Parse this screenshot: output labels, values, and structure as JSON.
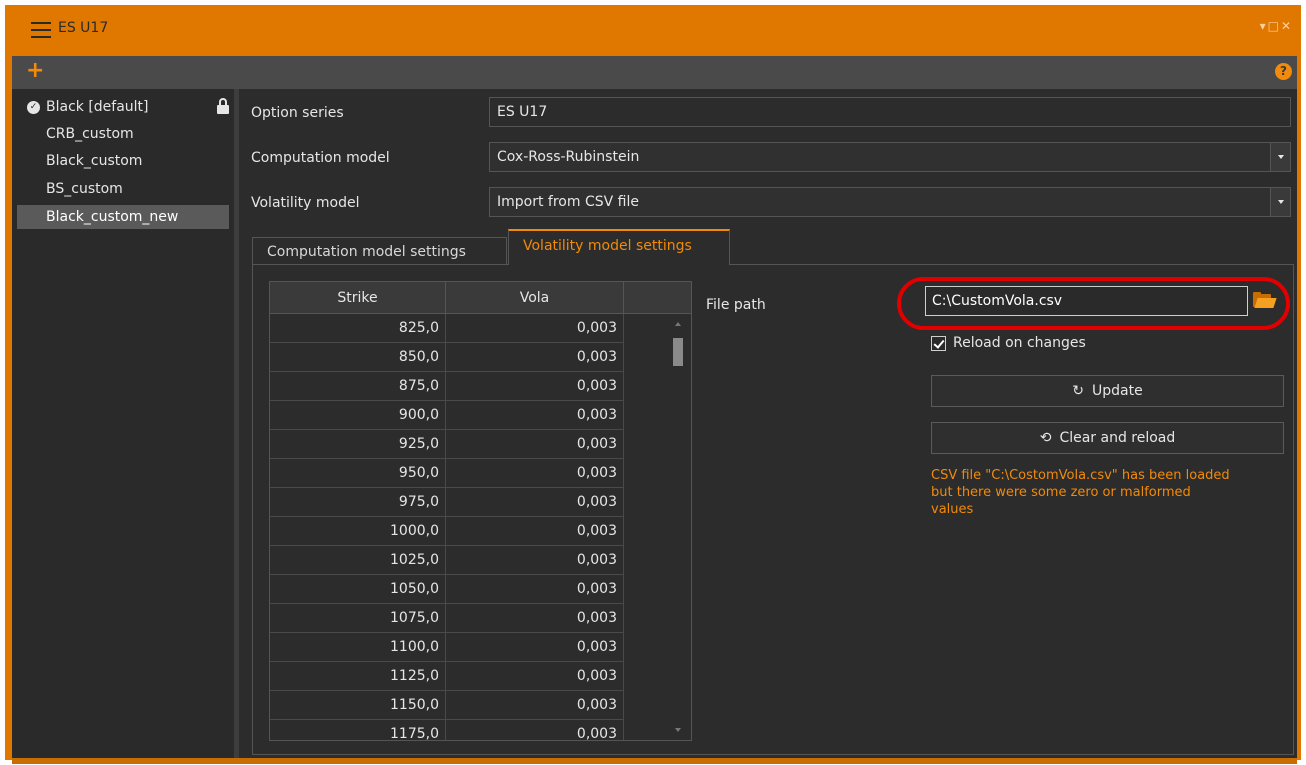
{
  "window": {
    "title": "ES U17",
    "controls": "▾□✕"
  },
  "toolbar": {
    "add_glyph": "+",
    "help_glyph": "?"
  },
  "sidebar": {
    "items": [
      {
        "label": "Black [default]",
        "default": true,
        "locked": true
      },
      {
        "label": "CRB_custom"
      },
      {
        "label": "Black_custom"
      },
      {
        "label": "BS_custom"
      },
      {
        "label": "Black_custom_new",
        "selected": true
      }
    ]
  },
  "form": {
    "option_series_label": "Option series",
    "option_series_value": "ES U17",
    "computation_model_label": "Computation model",
    "computation_model_value": "Cox-Ross-Rubinstein",
    "volatility_model_label": "Volatility model",
    "volatility_model_value": "Import from CSV file"
  },
  "tabs": [
    {
      "label": "Computation model settings",
      "active": false
    },
    {
      "label": "Volatility model settings",
      "active": true
    }
  ],
  "grid": {
    "headers": [
      "Strike",
      "Vola",
      ""
    ],
    "rows": [
      [
        "825,0",
        "0,003"
      ],
      [
        "850,0",
        "0,003"
      ],
      [
        "875,0",
        "0,003"
      ],
      [
        "900,0",
        "0,003"
      ],
      [
        "925,0",
        "0,003"
      ],
      [
        "950,0",
        "0,003"
      ],
      [
        "975,0",
        "0,003"
      ],
      [
        "1000,0",
        "0,003"
      ],
      [
        "1025,0",
        "0,003"
      ],
      [
        "1050,0",
        "0,003"
      ],
      [
        "1075,0",
        "0,003"
      ],
      [
        "1100,0",
        "0,003"
      ],
      [
        "1125,0",
        "0,003"
      ],
      [
        "1150,0",
        "0,003"
      ],
      [
        "1175,0",
        "0,003"
      ]
    ]
  },
  "volatility_settings": {
    "file_path_label": "File path",
    "file_path_value": "C:\\CustomVola.csv",
    "reload_label": "Reload on changes",
    "reload_checked": true,
    "update_label": "Update",
    "clear_reload_label": "Clear and reload",
    "status_message": "CSV file \"C:\\CostomVola.csv\" has been loaded but there were some zero or malformed values"
  },
  "colors": {
    "accent": "#f28a0a",
    "frame": "#e07800",
    "highlight_ring": "#e00000",
    "background": "#2c2c2c"
  },
  "icons": {
    "menu": "hamburger-icon",
    "add": "plus-icon",
    "help": "help-icon",
    "default": "check-circle-icon",
    "lock": "lock-icon",
    "folder": "folder-open-icon",
    "update": "refresh-icon",
    "clear": "history-icon"
  }
}
